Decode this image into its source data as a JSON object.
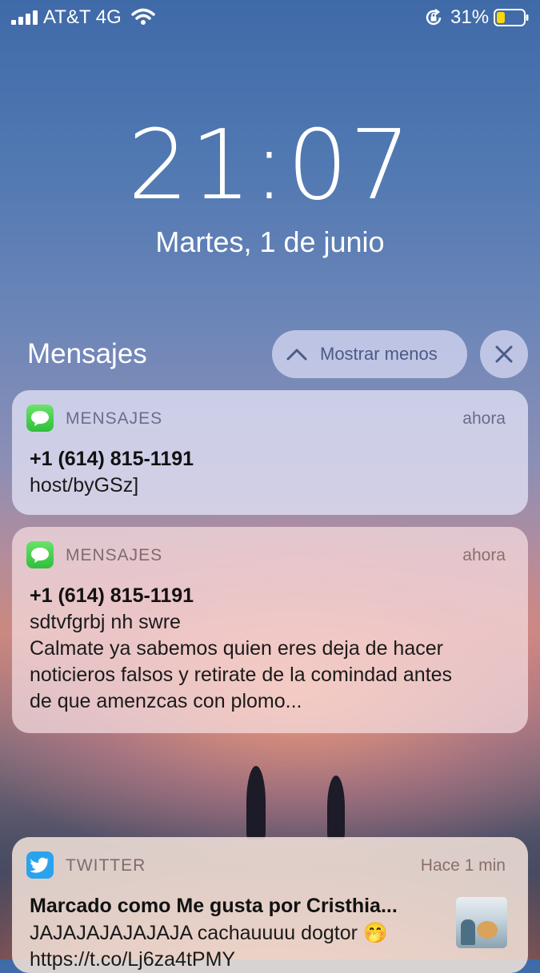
{
  "status_bar": {
    "carrier": "AT&T 4G",
    "battery_percent": "31%",
    "battery_level": 0.31
  },
  "lockscreen": {
    "time": "21:07",
    "date": "Martes, 1 de junio"
  },
  "group": {
    "title": "Mensajes",
    "show_less_label": "Mostrar menos"
  },
  "notifications": [
    {
      "app": "MENSAJES",
      "time": "ahora",
      "sender": "+1 (614) 815-1191",
      "lines": [
        "host/byGSz]"
      ]
    },
    {
      "app": "MENSAJES",
      "time": "ahora",
      "sender": "+1 (614) 815-1191",
      "lines": [
        "sdtvfgrbj nh swre",
        "Calmate ya sabemos quien eres deja de hacer",
        "noticieros falsos y retirate de la comindad antes",
        "de que amenzcas con plomo..."
      ]
    },
    {
      "app": "TWITTER",
      "time": "Hace 1 min",
      "sender": "Marcado como Me gusta por Cristhia...",
      "lines": [
        "JAJAJAJAJAJAJA cachauuuu dogtor 🤭",
        "https://t.co/Lj6za4tPMY"
      ]
    }
  ],
  "colors": {
    "messages_green": "#34c759",
    "twitter_blue": "#2aa3ef"
  }
}
